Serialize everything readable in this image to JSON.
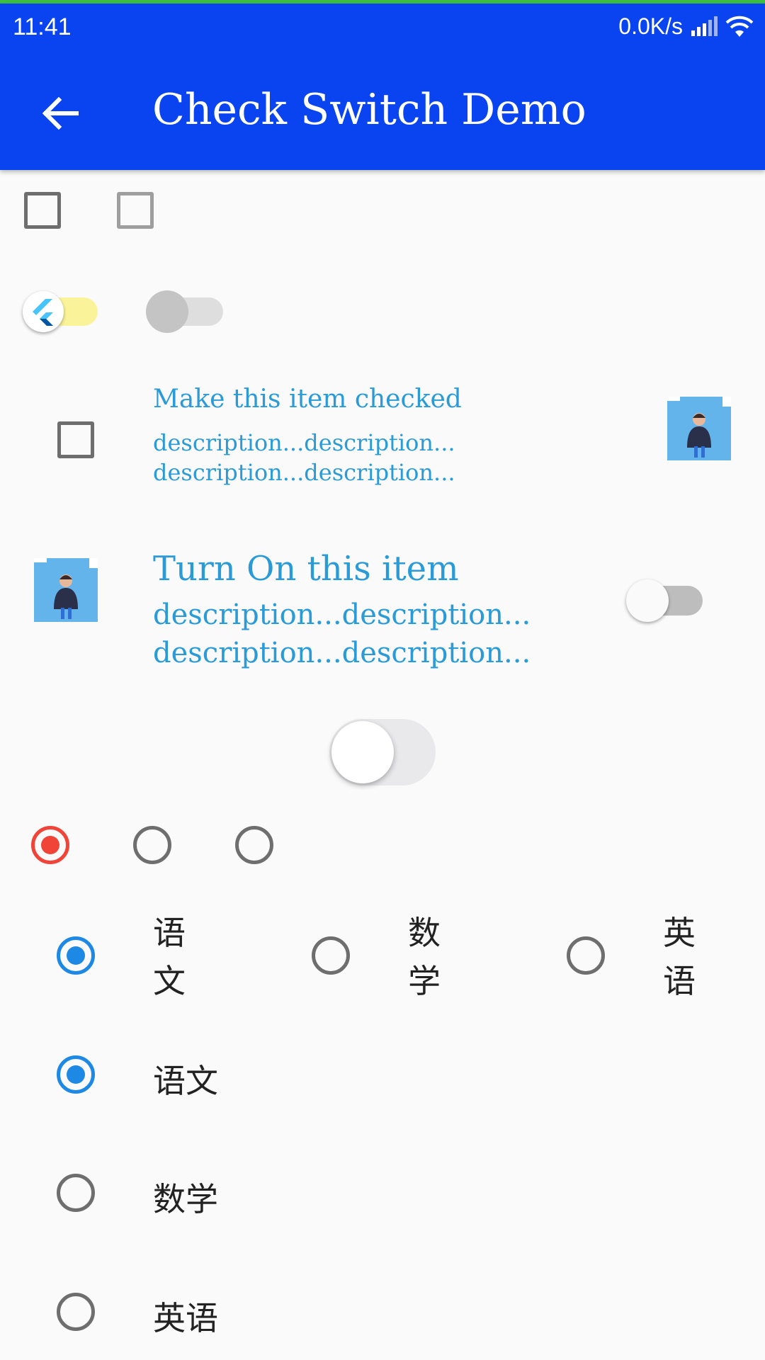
{
  "status_bar": {
    "time": "11:41",
    "network_speed": "0.0K/s"
  },
  "app_bar": {
    "title": "Check Switch Demo"
  },
  "list_items": {
    "checkbox_item": {
      "title": "Make this item checked",
      "subtitle_line1": "description...description...",
      "subtitle_line2": "description...description..."
    },
    "switch_item": {
      "title": "Turn On this item",
      "subtitle_line1": "description...description...",
      "subtitle_line2": "description...description..."
    }
  },
  "radio_row_labels": [
    "语文",
    "数学",
    "英语"
  ],
  "radio_list_labels": [
    "语文",
    "数学",
    "英语"
  ],
  "colors": {
    "app_bar": "#0a44f0",
    "accent_text": "#2a9bd6",
    "radio_selected_red": "#f04438",
    "radio_selected_blue": "#1e88e5",
    "switch_active_track": "#fbf39a"
  },
  "states": {
    "checkbox_1": false,
    "checkbox_2": false,
    "switch_1": true,
    "switch_2": false,
    "list_checkbox": false,
    "list_switch": false,
    "ios_switch": false,
    "radio_top_selected_index": 0,
    "radio_row_selected_index": 0,
    "radio_list_selected_index": 0
  }
}
